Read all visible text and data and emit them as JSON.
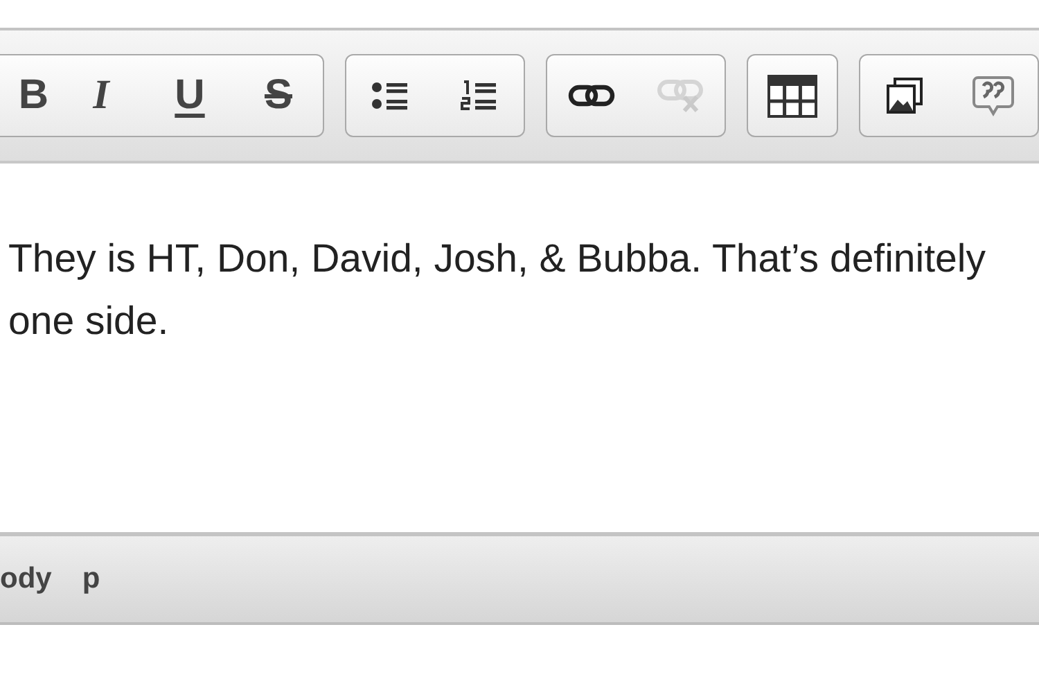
{
  "toolbar": {
    "groups": [
      {
        "buttons": [
          {
            "kind": "bold",
            "label": "B",
            "disabled": false
          },
          {
            "kind": "italic",
            "label": "I",
            "disabled": false
          },
          {
            "kind": "underline",
            "label": "U",
            "disabled": false
          },
          {
            "kind": "strike",
            "label": "S",
            "disabled": false
          }
        ]
      },
      {
        "buttons": [
          {
            "kind": "bullet-list",
            "disabled": false
          },
          {
            "kind": "numbered-list",
            "disabled": false
          }
        ]
      },
      {
        "buttons": [
          {
            "kind": "link",
            "disabled": false
          },
          {
            "kind": "unlink",
            "disabled": true
          }
        ]
      },
      {
        "buttons": [
          {
            "kind": "table",
            "disabled": false
          }
        ]
      },
      {
        "buttons": [
          {
            "kind": "image",
            "disabled": false
          },
          {
            "kind": "quote",
            "disabled": false
          }
        ]
      }
    ]
  },
  "editor": {
    "text": "They is HT, Don, David, Josh, & Bubba. That’s definitely one side."
  },
  "status_bar": {
    "path": [
      "ody",
      "p"
    ]
  }
}
